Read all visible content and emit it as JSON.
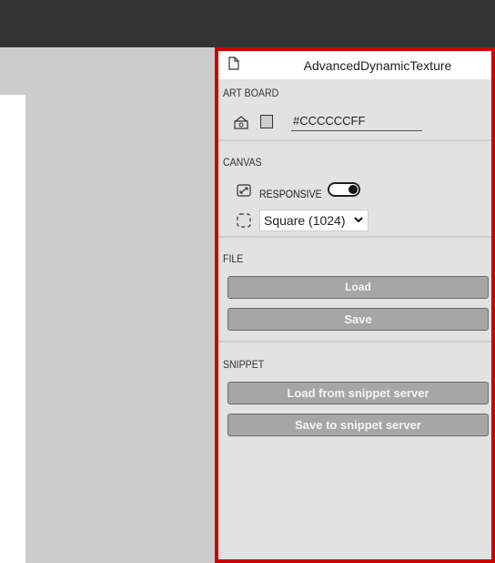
{
  "panel": {
    "title": "AdvancedDynamicTexture"
  },
  "sections": {
    "art_board": {
      "label": "ART BOARD",
      "color_value": "#CCCCCCFF",
      "swatch_color": "#CCCCCC"
    },
    "canvas": {
      "label": "CANVAS",
      "responsive_label": "RESPONSIVE",
      "responsive_on": true,
      "size_selected": "Square (1024)"
    },
    "file": {
      "label": "FILE",
      "load_label": "Load",
      "save_label": "Save"
    },
    "snippet": {
      "label": "SNIPPET",
      "load_label": "Load from snippet server",
      "save_label": "Save to snippet server"
    }
  },
  "colors": {
    "accent_border": "#cc0000",
    "topbar": "#333333",
    "workspace": "#cccccc",
    "panel_bg": "#e2e2e2",
    "button_bg": "#a6a6a6"
  }
}
